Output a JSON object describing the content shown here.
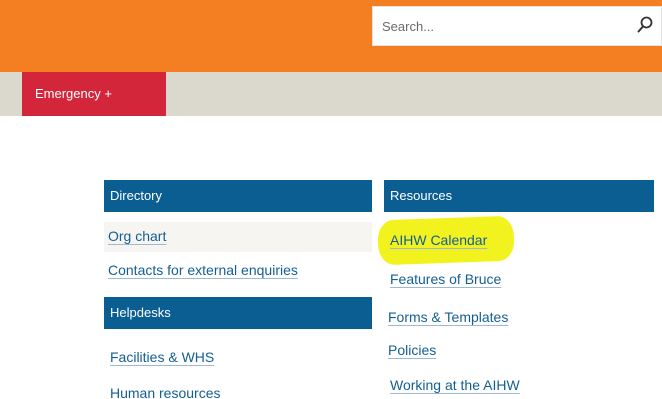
{
  "search": {
    "placeholder": "Search..."
  },
  "nav": {
    "emergency_label": "Emergency +"
  },
  "directory": {
    "title": "Directory",
    "links": [
      "Org chart",
      "Contacts for external enquiries"
    ]
  },
  "helpdesks": {
    "title": "Helpdesks",
    "links": [
      "Facilities & WHS",
      "Human resources"
    ]
  },
  "resources": {
    "title": "Resources",
    "links": [
      "AIHW Calendar",
      "Features of Bruce",
      "Forms & Templates",
      "Policies",
      "Working at the AIHW"
    ]
  },
  "colors": {
    "header_orange": "#f47f22",
    "nav_beige": "#dbd8cd",
    "emergency_red": "#d3263b",
    "section_blue": "#0a5e92",
    "link_blue": "#135f93",
    "highlight_yellow": "#f2f21f"
  }
}
